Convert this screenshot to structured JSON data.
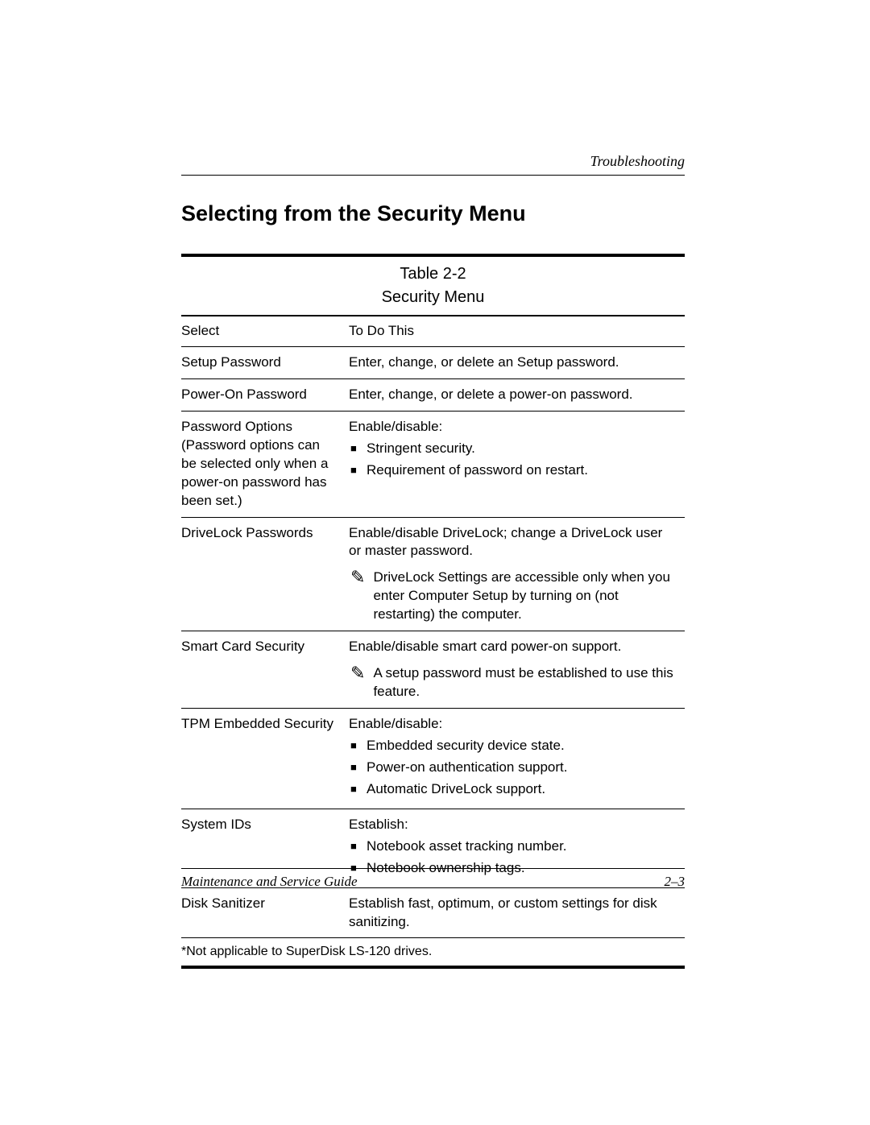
{
  "header": {
    "chapter": "Troubleshooting"
  },
  "section_title": "Selecting from the Security Menu",
  "table": {
    "caption": "Table 2-2",
    "title": "Security Menu",
    "head": {
      "col1": "Select",
      "col2": "To Do This"
    },
    "rows": {
      "setup_password": {
        "select": "Setup Password",
        "desc": "Enter, change, or delete an Setup password."
      },
      "power_on_password": {
        "select": "Power-On Password",
        "desc": "Enter, change, or delete a power-on password."
      },
      "password_options": {
        "select": "Password Options (Password options can be selected only when a power-on password has been set.)",
        "intro": "Enable/disable:",
        "b1": "Stringent security.",
        "b2": "Requirement of password on restart."
      },
      "drivelock": {
        "select": "DriveLock Passwords",
        "desc": "Enable/disable DriveLock; change a DriveLock user or master password.",
        "note": "DriveLock Settings are accessible only when you enter Computer Setup by turning on (not restarting) the computer."
      },
      "smart_card": {
        "select": "Smart Card Security",
        "desc": "Enable/disable smart card power-on support.",
        "note": "A setup password must be established to use this feature."
      },
      "tpm": {
        "select": "TPM Embedded Security",
        "intro": "Enable/disable:",
        "b1": "Embedded security device state.",
        "b2": "Power-on authentication support.",
        "b3": "Automatic DriveLock support."
      },
      "system_ids": {
        "select": "System IDs",
        "intro": "Establish:",
        "b1": "Notebook asset tracking number.",
        "b2": "Notebook ownership tags."
      },
      "disk_sanitizer": {
        "select": "Disk Sanitizer",
        "desc": "Establish fast, optimum, or custom settings for disk sanitizing."
      }
    },
    "footnote": "*Not applicable to SuperDisk LS-120 drives."
  },
  "footer": {
    "left": "Maintenance and Service Guide",
    "right": "2–3"
  },
  "icons": {
    "note_glyph": "✎"
  }
}
